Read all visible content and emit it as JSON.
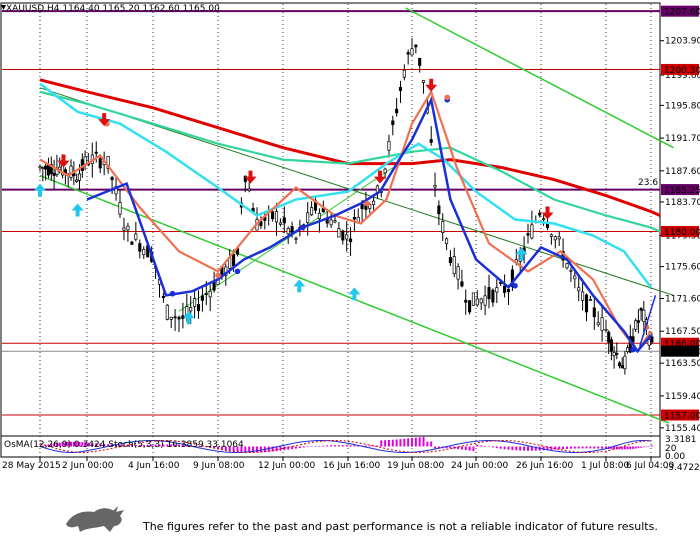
{
  "header": {
    "symbol_line": "XAUUSD,H4  1164.40 1165.20 1162.60 1165.00"
  },
  "price_axis": {
    "ticks": [
      "1203.90",
      "1199.60",
      "1195.80",
      "1191.70",
      "1187.60",
      "1183.70",
      "1179.50",
      "1175.60",
      "1171.60",
      "1167.50",
      "1163.50",
      "1159.40",
      "1155.40"
    ]
  },
  "badges": [
    {
      "label": "1207.60",
      "price": 1207.6
    },
    {
      "label": "1200.30",
      "price": 1200.3
    },
    {
      "label": "1185.25",
      "price": 1185.25
    },
    {
      "label": "1180.00",
      "price": 1180.0
    },
    {
      "label": "1166.00",
      "price": 1166.0
    },
    {
      "label": "1165.00",
      "price": 1165.0
    },
    {
      "label": "1157.00",
      "price": 1157.0
    }
  ],
  "marker_236": "23.6",
  "time_axis": {
    "labels": [
      "28 May 2015",
      "2 Jun 00:00",
      "4 Jun 16:00",
      "9 Jun 08:00",
      "12 Jun 00:00",
      "16 Jun 16:00",
      "19 Jun 08:00",
      "24 Jun 00:00",
      "26 Jun 16:00",
      "1 Jul 08:00",
      "6 Jul 04:00"
    ]
  },
  "indicator": {
    "label": "OsMA(12,26,9) 0.3424  Stoch(5,3,3) 16.3859 33.1064",
    "ticks": [
      "3.3181",
      "0.00",
      "20",
      "-3.4722"
    ]
  },
  "colors": {
    "bg": "#ffffff",
    "candle": "#000000",
    "ma_red": "#e00000",
    "ma_cyan": "#33e0f0",
    "ma_teal": "#33d69a",
    "ma_salmon": "#f07050",
    "ma_blue": "#1a2fd8",
    "channel": "#33cc33",
    "level": "#cc0000",
    "level_purple": "#660066",
    "osma": "#e000e0",
    "stoch_main": "#1a2fd8",
    "stoch_signal": "#cc0000"
  },
  "footer": {
    "disclaimer": "The figures refer to the past and past performance is not a reliable indicator of future results."
  },
  "chart_data": {
    "type": "line",
    "title": "XAUUSD,H4",
    "last_bar": {
      "open": 1164.4,
      "high": 1165.2,
      "low": 1162.6,
      "close": 1165.0
    },
    "ylim": [
      1154.5,
      1208.5
    ],
    "x": [
      "28 May 2015",
      "2 Jun 00:00",
      "4 Jun 16:00",
      "9 Jun 08:00",
      "12 Jun 00:00",
      "16 Jun 16:00",
      "19 Jun 08:00",
      "24 Jun 00:00",
      "26 Jun 16:00",
      "1 Jul 08:00",
      "6 Jul 04:00"
    ],
    "series": [
      {
        "values": [
          1188.5,
          1189.0,
          1175.0,
          1181.0,
          1181.5,
          1184.0,
          1200.0,
          1172.5,
          1177.5,
          1166.0,
          1166.0
        ]
      },
      {
        "values": [
          1199.0,
          1197.0,
          1192.0,
          1190.0,
          1188.5,
          1187.5,
          1188.0,
          1188.5,
          1185.0,
          1178.0,
          1176.5
        ]
      }
    ],
    "horizontal_levels": [
      1207.6,
      1200.3,
      1185.25,
      1180.0,
      1166.0,
      1165.0,
      1157.0
    ]
  }
}
